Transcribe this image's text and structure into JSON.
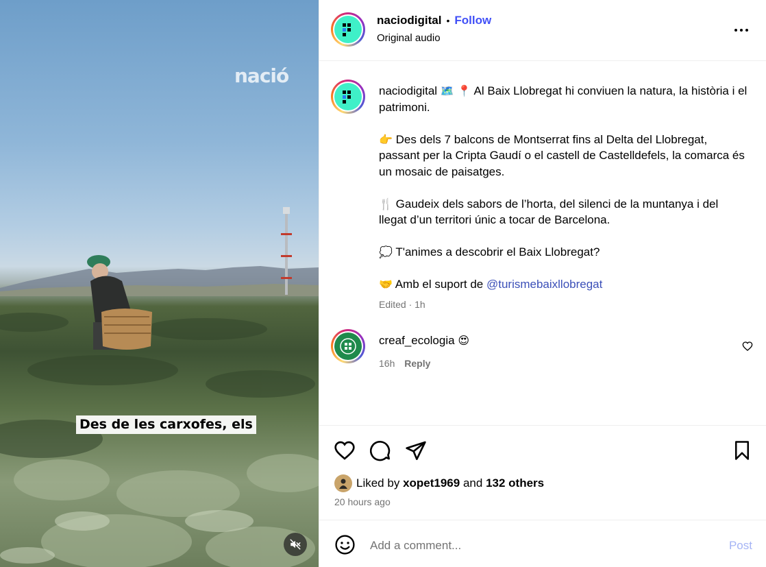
{
  "video": {
    "watermark": "nació",
    "subtitle": "Des de les carxofes, els",
    "mute_icon": "speaker-muted-icon"
  },
  "header": {
    "username": "naciodigital",
    "separator": "•",
    "follow_label": "Follow",
    "audio_label": "Original audio",
    "more_icon": "more-horizontal-icon"
  },
  "caption": {
    "username": "naciodigital",
    "line1_emoji": "🗺️ 📍",
    "line1_text": "Al Baix Llobregat hi conviuen la natura, la història i el patrimoni.",
    "para2_emoji": "👉",
    "para2_text": "Des dels 7 balcons de Montserrat fins al Delta del Llobregat, passant per la Cripta Gaudí o el castell de Castelldefels, la comarca és un mosaic de paisatges.",
    "para3_emoji": "🍴",
    "para3_text": "Gaudeix dels sabors de l’horta, del silenci de la muntanya i del llegat d’un territori únic a tocar de Barcelona.",
    "para4_emoji": "💭",
    "para4_text": "T'animes a descobrir el Baix Llobregat?",
    "para5_emoji": "🤝",
    "para5_text": "Amb el suport de",
    "mention": "@turismebaixllobregat",
    "edited": "Edited · 1h"
  },
  "comments": [
    {
      "username": "creaf_ecologia",
      "emoji": "😍",
      "time": "16h",
      "reply_label": "Reply"
    }
  ],
  "actions": {
    "like_icon": "heart-icon",
    "comment_icon": "comment-icon",
    "share_icon": "paper-plane-icon",
    "save_icon": "bookmark-icon"
  },
  "likes": {
    "prefix": "Liked by",
    "user": "xopet1969",
    "and": "and",
    "others": "132 others",
    "time_ago": "20 hours ago"
  },
  "add_comment": {
    "placeholder": "Add a comment...",
    "post_label": "Post",
    "emoji_icon": "smiley-icon"
  },
  "colors": {
    "follow_blue": "#4150f7",
    "mention_blue": "#3b4fb8",
    "post_button_disabled": "#a5b4f5",
    "secondary_text": "#737373",
    "avatar_mint": "#3ff0c8",
    "creaf_green": "#1f8a4c"
  }
}
